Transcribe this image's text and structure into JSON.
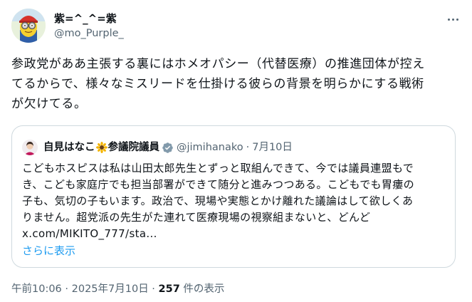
{
  "author": {
    "display_name": "紫=^_^=紫",
    "handle": "@mo_Purple_",
    "avatar_icon": "avatar-minion-icon"
  },
  "tweet": {
    "lines": [
      "参政党がああ主張する裏にはホメオパシー（代替医療）の推進団体が控え",
      "てるからで、様々なミスリードを仕掛ける彼らの背景を明らかにする戦術",
      "が欠けてる。"
    ]
  },
  "quote": {
    "name": "自見はなこ",
    "name_suffix": "参議院議員",
    "handle": "@jimihanako",
    "separator": "·",
    "date": "7月10日",
    "lines": [
      "こどもホスピスは私は山田太郎先生とずっと取組んできて、今では議員連盟もで",
      "き、こども家庭庁でも担当部署ができて随分と進みつつある。こどもでも胃瘻の",
      "子も、気切の子もいます。政治で、現場や実態とかけ離れた議論はして欲しくあ",
      "りません。超党派の先生がた連れて医療現場の視察組まないと、どんど",
      "x.com/MIKITO_777/sta..."
    ],
    "show_more": "さらに表示"
  },
  "meta": {
    "timestamp": "午前10:06 · 2025年7月10日 · ",
    "views": "257",
    "views_label": " 件の表示"
  },
  "colors": {
    "text": "#0f1419",
    "secondary": "#536471",
    "link": "#1d9bf0",
    "border": "#cfd9de",
    "verified_gray": "#829aab"
  }
}
